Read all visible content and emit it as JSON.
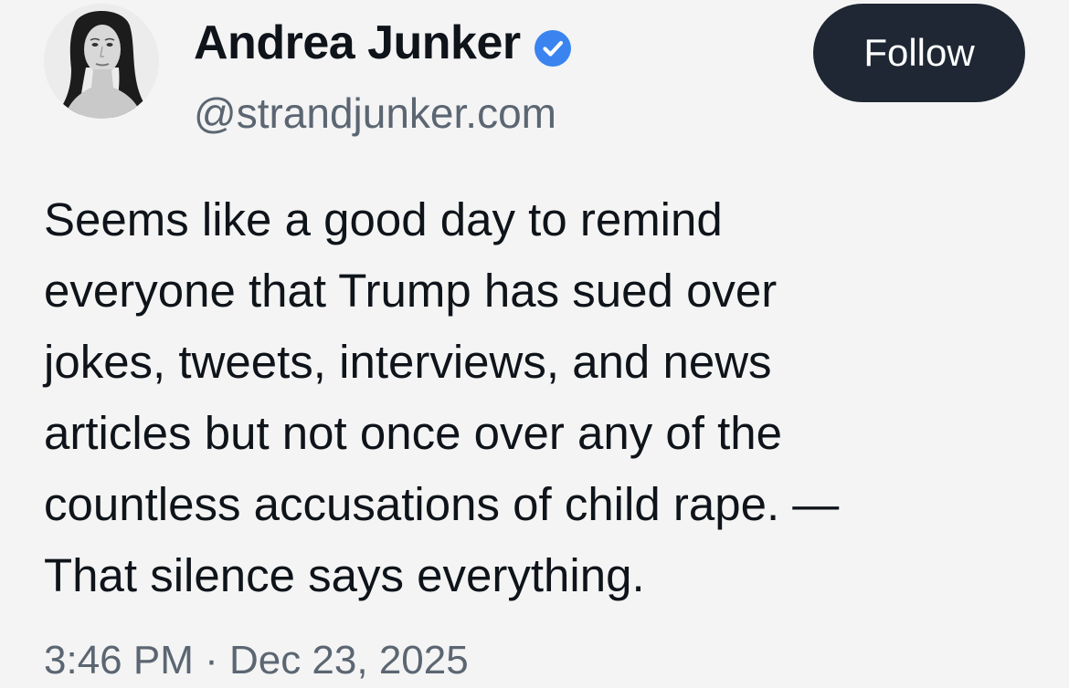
{
  "author": {
    "display_name": "Andrea Junker",
    "handle": "@strandjunker.com",
    "verified_icon": "verified-badge-icon",
    "verified_color": "#3a84ef",
    "avatar": "profile-photo"
  },
  "actions": {
    "follow_label": "Follow",
    "follow_bg": "#1e2733"
  },
  "post": {
    "lines": [
      "Seems like a good day to remind",
      "everyone that Trump has sued over",
      "jokes, tweets, interviews, and news",
      "articles but not once over any of the",
      "countless accusations of child rape. —",
      "That silence says everything."
    ],
    "timestamp": "3:46 PM · Dec 23, 2025"
  }
}
